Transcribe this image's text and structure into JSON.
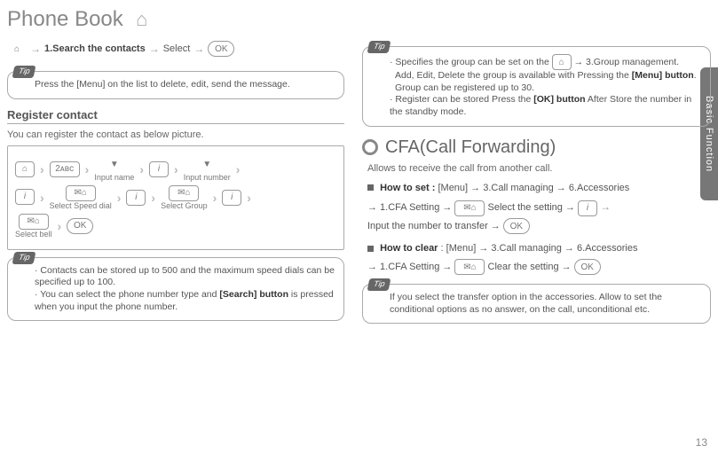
{
  "page": {
    "title": "Phone Book",
    "pageNumber": "13",
    "sideTab": "Basic Function"
  },
  "left": {
    "search": {
      "prefix": "1.Search the contacts",
      "select": "Select",
      "ok": "OK"
    },
    "tip1": "Press the [Menu] on the list to delete, edit, send the message.",
    "register": {
      "header": "Register contact",
      "desc": "You can register the contact as below picture.",
      "labels": {
        "inputName": "Input name",
        "inputNumber": "Input number",
        "selectSpeed": "Select Speed dial",
        "selectGroup": "Select Group",
        "selectBell": "Select bell"
      },
      "ok": "OK"
    },
    "tip2a": "· Contacts can be stored up to 500 and the maximum speed dials can be specified up to 100.",
    "tip2b_a": "· You can select the phone number type and ",
    "tip2b_bold": "[Search] button",
    "tip2b_b": " is pressed when you input the phone number."
  },
  "right": {
    "tipTop": {
      "l1a": "· Specifies the group can be set on the ",
      "l1b": " → 3.Group management.",
      "l2a": "Add, Edit, Delete the group is available with Pressing the ",
      "l2bold": "[Menu] button",
      "l2b": ". Group can be registered up to 30.",
      "l3a": "· Register can be stored Press the ",
      "l3bold": "[OK] button",
      "l3b": " After Store the number in the standby mode."
    },
    "cfa": {
      "title": "CFA(Call Forwarding)",
      "desc": "Allows to receive the call from another call.",
      "howSet": {
        "label": "How to set :",
        "p1": "[Menu] → 3.Call managing → 6.Accessories",
        "p2a": "→ 1.CFA Setting → ",
        "p2b": " Select the setting → ",
        "p3": "Input the number to transfer → "
      },
      "howClear": {
        "label": "How to clear",
        "p1": ": [Menu] → 3.Call managing → 6.Accessories",
        "p2a": "→ 1.CFA Setting → ",
        "p2b": " Clear the setting → "
      },
      "ok": "OK"
    },
    "tipBottom": "If you select the transfer option in the accessories. Allow to set the conditional options as no answer, on the call, unconditional etc."
  }
}
